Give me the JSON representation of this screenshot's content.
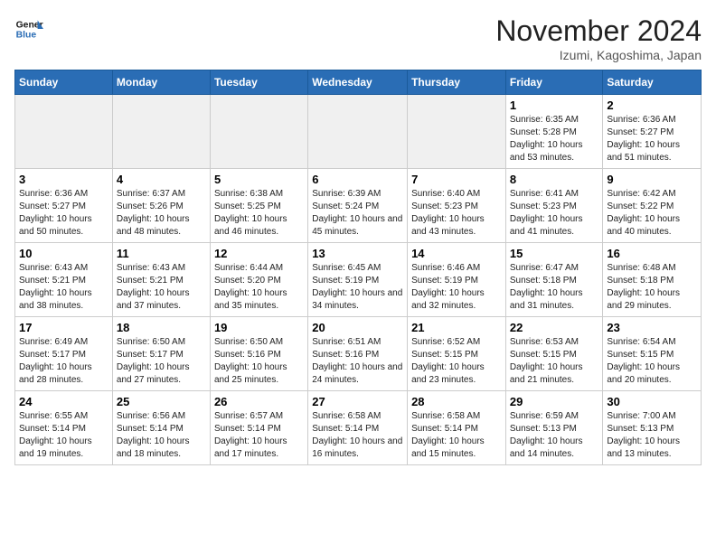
{
  "header": {
    "logo_line1": "General",
    "logo_line2": "Blue",
    "month": "November 2024",
    "location": "Izumi, Kagoshima, Japan"
  },
  "weekdays": [
    "Sunday",
    "Monday",
    "Tuesday",
    "Wednesday",
    "Thursday",
    "Friday",
    "Saturday"
  ],
  "weeks": [
    [
      {
        "day": "",
        "empty": true
      },
      {
        "day": "",
        "empty": true
      },
      {
        "day": "",
        "empty": true
      },
      {
        "day": "",
        "empty": true
      },
      {
        "day": "",
        "empty": true
      },
      {
        "day": "1",
        "sunrise": "Sunrise: 6:35 AM",
        "sunset": "Sunset: 5:28 PM",
        "daylight": "Daylight: 10 hours and 53 minutes."
      },
      {
        "day": "2",
        "sunrise": "Sunrise: 6:36 AM",
        "sunset": "Sunset: 5:27 PM",
        "daylight": "Daylight: 10 hours and 51 minutes."
      }
    ],
    [
      {
        "day": "3",
        "sunrise": "Sunrise: 6:36 AM",
        "sunset": "Sunset: 5:27 PM",
        "daylight": "Daylight: 10 hours and 50 minutes."
      },
      {
        "day": "4",
        "sunrise": "Sunrise: 6:37 AM",
        "sunset": "Sunset: 5:26 PM",
        "daylight": "Daylight: 10 hours and 48 minutes."
      },
      {
        "day": "5",
        "sunrise": "Sunrise: 6:38 AM",
        "sunset": "Sunset: 5:25 PM",
        "daylight": "Daylight: 10 hours and 46 minutes."
      },
      {
        "day": "6",
        "sunrise": "Sunrise: 6:39 AM",
        "sunset": "Sunset: 5:24 PM",
        "daylight": "Daylight: 10 hours and 45 minutes."
      },
      {
        "day": "7",
        "sunrise": "Sunrise: 6:40 AM",
        "sunset": "Sunset: 5:23 PM",
        "daylight": "Daylight: 10 hours and 43 minutes."
      },
      {
        "day": "8",
        "sunrise": "Sunrise: 6:41 AM",
        "sunset": "Sunset: 5:23 PM",
        "daylight": "Daylight: 10 hours and 41 minutes."
      },
      {
        "day": "9",
        "sunrise": "Sunrise: 6:42 AM",
        "sunset": "Sunset: 5:22 PM",
        "daylight": "Daylight: 10 hours and 40 minutes."
      }
    ],
    [
      {
        "day": "10",
        "sunrise": "Sunrise: 6:43 AM",
        "sunset": "Sunset: 5:21 PM",
        "daylight": "Daylight: 10 hours and 38 minutes."
      },
      {
        "day": "11",
        "sunrise": "Sunrise: 6:43 AM",
        "sunset": "Sunset: 5:21 PM",
        "daylight": "Daylight: 10 hours and 37 minutes."
      },
      {
        "day": "12",
        "sunrise": "Sunrise: 6:44 AM",
        "sunset": "Sunset: 5:20 PM",
        "daylight": "Daylight: 10 hours and 35 minutes."
      },
      {
        "day": "13",
        "sunrise": "Sunrise: 6:45 AM",
        "sunset": "Sunset: 5:19 PM",
        "daylight": "Daylight: 10 hours and 34 minutes."
      },
      {
        "day": "14",
        "sunrise": "Sunrise: 6:46 AM",
        "sunset": "Sunset: 5:19 PM",
        "daylight": "Daylight: 10 hours and 32 minutes."
      },
      {
        "day": "15",
        "sunrise": "Sunrise: 6:47 AM",
        "sunset": "Sunset: 5:18 PM",
        "daylight": "Daylight: 10 hours and 31 minutes."
      },
      {
        "day": "16",
        "sunrise": "Sunrise: 6:48 AM",
        "sunset": "Sunset: 5:18 PM",
        "daylight": "Daylight: 10 hours and 29 minutes."
      }
    ],
    [
      {
        "day": "17",
        "sunrise": "Sunrise: 6:49 AM",
        "sunset": "Sunset: 5:17 PM",
        "daylight": "Daylight: 10 hours and 28 minutes."
      },
      {
        "day": "18",
        "sunrise": "Sunrise: 6:50 AM",
        "sunset": "Sunset: 5:17 PM",
        "daylight": "Daylight: 10 hours and 27 minutes."
      },
      {
        "day": "19",
        "sunrise": "Sunrise: 6:50 AM",
        "sunset": "Sunset: 5:16 PM",
        "daylight": "Daylight: 10 hours and 25 minutes."
      },
      {
        "day": "20",
        "sunrise": "Sunrise: 6:51 AM",
        "sunset": "Sunset: 5:16 PM",
        "daylight": "Daylight: 10 hours and 24 minutes."
      },
      {
        "day": "21",
        "sunrise": "Sunrise: 6:52 AM",
        "sunset": "Sunset: 5:15 PM",
        "daylight": "Daylight: 10 hours and 23 minutes."
      },
      {
        "day": "22",
        "sunrise": "Sunrise: 6:53 AM",
        "sunset": "Sunset: 5:15 PM",
        "daylight": "Daylight: 10 hours and 21 minutes."
      },
      {
        "day": "23",
        "sunrise": "Sunrise: 6:54 AM",
        "sunset": "Sunset: 5:15 PM",
        "daylight": "Daylight: 10 hours and 20 minutes."
      }
    ],
    [
      {
        "day": "24",
        "sunrise": "Sunrise: 6:55 AM",
        "sunset": "Sunset: 5:14 PM",
        "daylight": "Daylight: 10 hours and 19 minutes."
      },
      {
        "day": "25",
        "sunrise": "Sunrise: 6:56 AM",
        "sunset": "Sunset: 5:14 PM",
        "daylight": "Daylight: 10 hours and 18 minutes."
      },
      {
        "day": "26",
        "sunrise": "Sunrise: 6:57 AM",
        "sunset": "Sunset: 5:14 PM",
        "daylight": "Daylight: 10 hours and 17 minutes."
      },
      {
        "day": "27",
        "sunrise": "Sunrise: 6:58 AM",
        "sunset": "Sunset: 5:14 PM",
        "daylight": "Daylight: 10 hours and 16 minutes."
      },
      {
        "day": "28",
        "sunrise": "Sunrise: 6:58 AM",
        "sunset": "Sunset: 5:14 PM",
        "daylight": "Daylight: 10 hours and 15 minutes."
      },
      {
        "day": "29",
        "sunrise": "Sunrise: 6:59 AM",
        "sunset": "Sunset: 5:13 PM",
        "daylight": "Daylight: 10 hours and 14 minutes."
      },
      {
        "day": "30",
        "sunrise": "Sunrise: 7:00 AM",
        "sunset": "Sunset: 5:13 PM",
        "daylight": "Daylight: 10 hours and 13 minutes."
      }
    ]
  ]
}
